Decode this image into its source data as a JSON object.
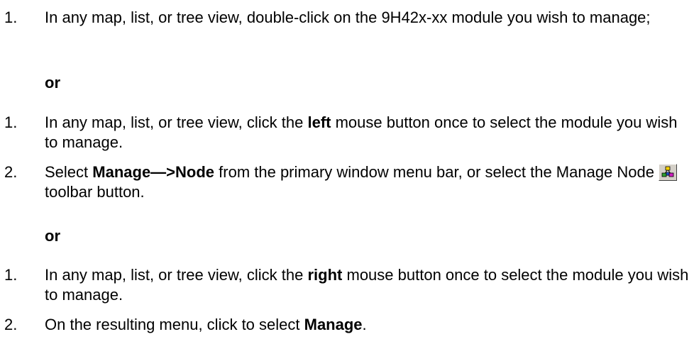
{
  "option_a": {
    "step1_num": "1.",
    "step1_text": "In any map, list, or tree view, double-click on the 9H42x-xx module you wish to manage;"
  },
  "or_1": "or",
  "option_b": {
    "step1_num": "1.",
    "step1_pre": "In any map, list, or tree view, click the ",
    "step1_bold": "left",
    "step1_post": " mouse button once to select the module you wish to manage.",
    "step2_num": "2.",
    "step2_pre": "Select ",
    "step2_bold": "Manage—>Node",
    "step2_mid": " from the primary window menu bar, or select the Manage Node",
    "step2_post": "toolbar button.",
    "toolbar_icon": "manage-node-icon"
  },
  "or_2": "or",
  "option_c": {
    "step1_num": "1.",
    "step1_pre": "In any map, list, or tree view, click the ",
    "step1_bold": "right",
    "step1_post": " mouse button once to select the module you wish to manage.",
    "step2_num": "2.",
    "step2_pre": "On the resulting menu, click to select ",
    "step2_bold": "Manage",
    "step2_post": "."
  }
}
